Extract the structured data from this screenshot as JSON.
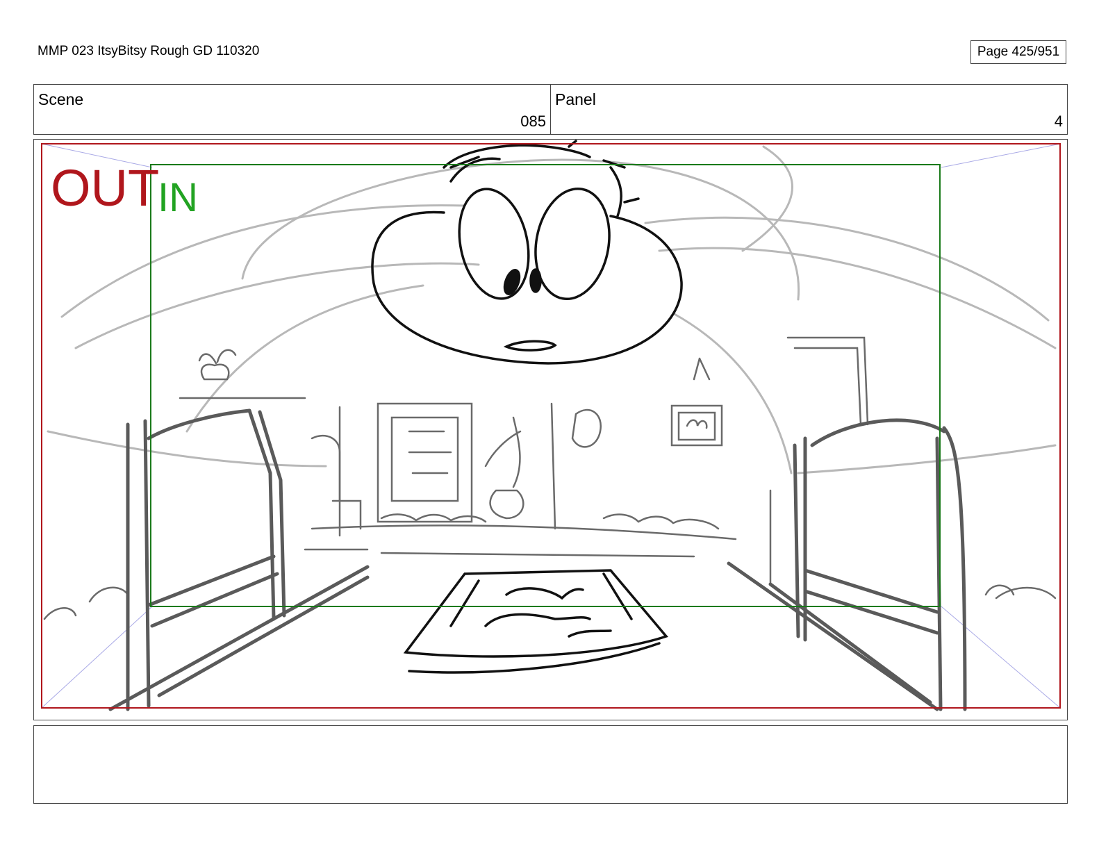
{
  "header": {
    "document_title": "MMP 023 ItsyBitsy Rough GD 110320",
    "page_indicator": "Page 425/951"
  },
  "info": {
    "scene_label": "Scene",
    "scene_value": "085",
    "panel_label": "Panel",
    "panel_value": "4"
  },
  "panel": {
    "out_label": "OUT",
    "in_label": "IN",
    "colors": {
      "out_frame": "#b0161c",
      "in_frame": "#1a7a1a",
      "out_text": "#b0161c",
      "in_text": "#22a322",
      "guide_lines": "#a9a9e6",
      "sketch_light": "#b8b8b8",
      "sketch_mid": "#6a6a6a",
      "sketch_dark": "#111111"
    }
  },
  "notes": {
    "text": ""
  }
}
